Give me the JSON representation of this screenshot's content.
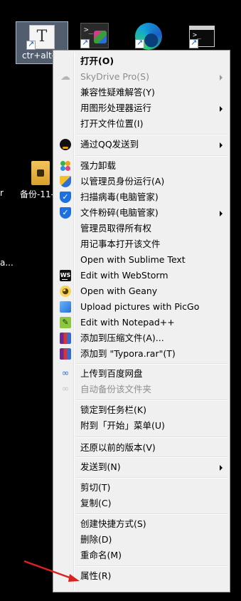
{
  "desktop": {
    "selected_icon_label": "ctr+alt-",
    "folder_label": "备份-11-",
    "edge_left_text": "r",
    "edge_left_text2": "a...",
    "typora_glyph": "T",
    "vs_prompt": ">_",
    "cmd_prompt": ">_"
  },
  "menu": {
    "items": [
      {
        "label": "打开(O)",
        "icon": "",
        "bold": true
      },
      {
        "label": "SkyDrive Pro(S)",
        "icon": "cloud-icon",
        "submenu": true,
        "disabled": true
      },
      {
        "label": "兼容性疑难解答(Y)",
        "icon": ""
      },
      {
        "label": "用图形处理器运行",
        "icon": "",
        "submenu": true
      },
      {
        "label": "打开文件位置(I)",
        "icon": ""
      },
      {
        "label": "通过QQ发送到",
        "icon": "qq-icon",
        "submenu": true
      },
      {
        "label": "强力卸载",
        "icon": "clover-icon"
      },
      {
        "label": "以管理员身份运行(A)",
        "icon": "uac-shield-icon"
      },
      {
        "label": "扫描病毒(电脑管家)",
        "icon": "tencent-shield-icon"
      },
      {
        "label": "文件粉碎(电脑管家)",
        "icon": "tencent-shield-icon",
        "submenu": true
      },
      {
        "label": "管理员取得所有权",
        "icon": ""
      },
      {
        "label": "用记事本打开该文件",
        "icon": ""
      },
      {
        "label": "Open with Sublime Text",
        "icon": ""
      },
      {
        "label": "Edit with WebStorm",
        "icon": "webstorm-icon"
      },
      {
        "label": "Open with Geany",
        "icon": "geany-icon"
      },
      {
        "label": "Upload pictures with PicGo",
        "icon": "picgo-icon"
      },
      {
        "label": "Edit with Notepad++",
        "icon": "notepadpp-icon"
      },
      {
        "label": "添加到压缩文件(A)...",
        "icon": "winrar-icon"
      },
      {
        "label": "添加到 \"Typora.rar\"(T)",
        "icon": "winrar-icon"
      },
      {
        "label": "上传到百度网盘",
        "icon": "baidu-netdisk-icon"
      },
      {
        "label": "自动备份该文件夹",
        "icon": "baidu-netdisk-icon",
        "disabled": true
      },
      {
        "label": "锁定到任务栏(K)",
        "icon": ""
      },
      {
        "label": "附到「开始」菜单(U)",
        "icon": ""
      },
      {
        "label": "还原以前的版本(V)",
        "icon": ""
      },
      {
        "label": "发送到(N)",
        "icon": "",
        "submenu": true
      },
      {
        "label": "剪切(T)",
        "icon": ""
      },
      {
        "label": "复制(C)",
        "icon": ""
      },
      {
        "label": "创建快捷方式(S)",
        "icon": ""
      },
      {
        "label": "删除(D)",
        "icon": ""
      },
      {
        "label": "重命名(M)",
        "icon": ""
      },
      {
        "label": "属性(R)",
        "icon": ""
      }
    ],
    "glyphs": {
      "ws": "WS",
      "geany": "◕",
      "npp": "✎",
      "cloud": "☁",
      "baidu": "∞"
    }
  },
  "annotation": {
    "arrow_color": "#e02020"
  }
}
